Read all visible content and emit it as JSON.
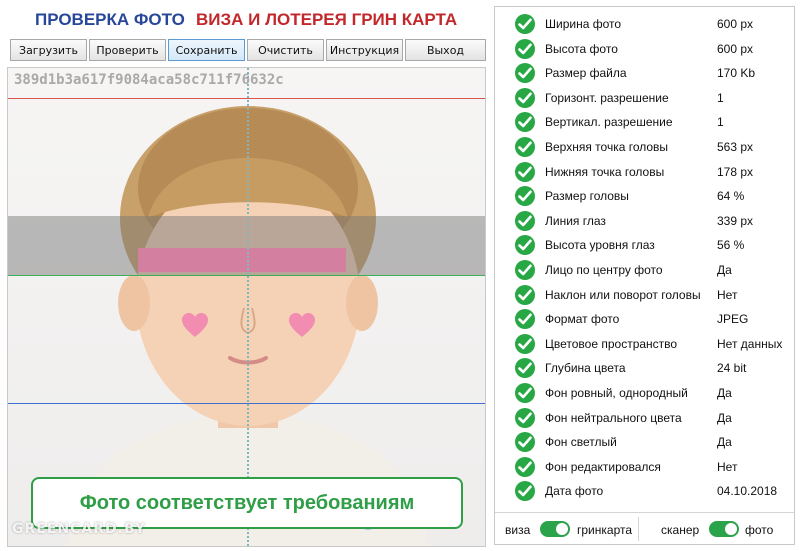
{
  "header": {
    "title_left": "ПРОВЕРКА ФОТО",
    "title_right": "ВИЗА И ЛОТЕРЕЯ ГРИН КАРТА",
    "title_left_color": "#27479a",
    "title_right_color": "#c2282b"
  },
  "toolbar": {
    "buttons": [
      {
        "label": "Загрузить"
      },
      {
        "label": "Проверить"
      },
      {
        "label": "Сохранить",
        "active": true
      },
      {
        "label": "Очистить"
      },
      {
        "label": "Инструкция"
      },
      {
        "label": "Выход"
      }
    ]
  },
  "photo": {
    "hash": "389d1b3a617f9084aca58c711f76632c",
    "status_text": "Фото соответствует требованиям",
    "watermark": "GREENCARD.BY",
    "guide_colors": {
      "top": "#d9534f",
      "eyes": "#3fae5a",
      "bottom": "#3f6fd1",
      "center": "#7fb7bd",
      "eye_bar": "#d27fa0",
      "hearts": "#f28cb1"
    }
  },
  "checks": {
    "status_icon": "check-circle-icon",
    "status_color": "#28a745",
    "items": [
      {
        "label": "Ширина фото",
        "value": "600 px"
      },
      {
        "label": "Высота фото",
        "value": "600 px"
      },
      {
        "label": "Размер файла",
        "value": "170 Kb"
      },
      {
        "label": "Горизонт. разрешение",
        "value": "1"
      },
      {
        "label": "Вертикал. разрешение",
        "value": "1"
      },
      {
        "label": "Верхняя точка головы",
        "value": "563 px"
      },
      {
        "label": "Нижняя точка головы",
        "value": "178 px"
      },
      {
        "label": "Размер головы",
        "value": "64 %"
      },
      {
        "label": "Линия глаз",
        "value": "339 px"
      },
      {
        "label": "Высота уровня глаз",
        "value": "56 %"
      },
      {
        "label": "Лицо по центру фото",
        "value": "Да"
      },
      {
        "label": "Наклон или поворот головы",
        "value": "Нет"
      },
      {
        "label": "Формат фото",
        "value": "JPEG"
      },
      {
        "label": "Цветовое пространство",
        "value": "Нет данных"
      },
      {
        "label": "Глубина цвета",
        "value": "24 bit"
      },
      {
        "label": "Фон ровный, однородный",
        "value": "Да"
      },
      {
        "label": "Фон нейтрального цвета",
        "value": "Да"
      },
      {
        "label": "Фон светлый",
        "value": "Да"
      },
      {
        "label": "Фон редактировался",
        "value": "Нет"
      },
      {
        "label": "Дата фото",
        "value": "04.10.2018"
      }
    ]
  },
  "footer": {
    "toggle1_left": "виза",
    "toggle1_right": "гринкарта",
    "toggle1_on": true,
    "toggle2_left": "сканер",
    "toggle2_right": "фото",
    "toggle2_on": true
  }
}
